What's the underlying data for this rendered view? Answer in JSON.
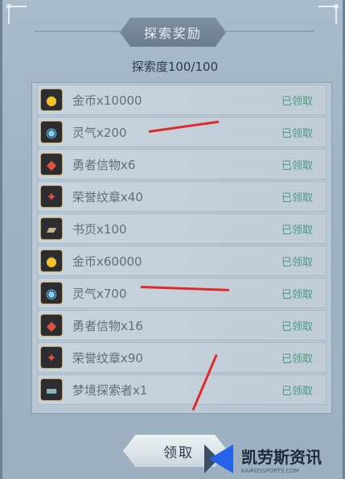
{
  "title": "探索奖励",
  "progress_text": "探索度100/100",
  "claim_button_label": "领取",
  "items": [
    {
      "name": "金币x10000",
      "icon": "gold-coin-icon",
      "glyph": "●",
      "color": "#f3c22b",
      "status": "已领取"
    },
    {
      "name": "灵气x200",
      "icon": "spirit-orb-icon",
      "glyph": "◉",
      "color": "#7fd3f2",
      "status": "已领取"
    },
    {
      "name": "勇者信物x6",
      "icon": "hero-token-icon",
      "glyph": "◆",
      "color": "#e0513a",
      "status": "已领取"
    },
    {
      "name": "荣誉纹章x40",
      "icon": "honor-emblem-icon",
      "glyph": "✦",
      "color": "#e0513a",
      "status": "已领取"
    },
    {
      "name": "书页x100",
      "icon": "book-page-icon",
      "glyph": "▰",
      "color": "#c7b38a",
      "status": "已领取"
    },
    {
      "name": "金币x60000",
      "icon": "gold-coin-icon",
      "glyph": "●",
      "color": "#f3c22b",
      "status": "已领取"
    },
    {
      "name": "灵气x700",
      "icon": "spirit-orb-icon",
      "glyph": "◉",
      "color": "#7fd3f2",
      "status": "已领取"
    },
    {
      "name": "勇者信物x16",
      "icon": "hero-token-icon",
      "glyph": "◆",
      "color": "#e0513a",
      "status": "已领取"
    },
    {
      "name": "荣誉纹章x90",
      "icon": "honor-emblem-icon",
      "glyph": "✦",
      "color": "#e0513a",
      "status": "已领取"
    },
    {
      "name": "梦境探索者x1",
      "icon": "explorer-badge-icon",
      "glyph": "▬",
      "color": "#8fb2b8",
      "status": "已领取"
    }
  ],
  "watermark": {
    "cn": "凯劳斯资讯",
    "en": "KAIROSSPORTS.COM"
  }
}
